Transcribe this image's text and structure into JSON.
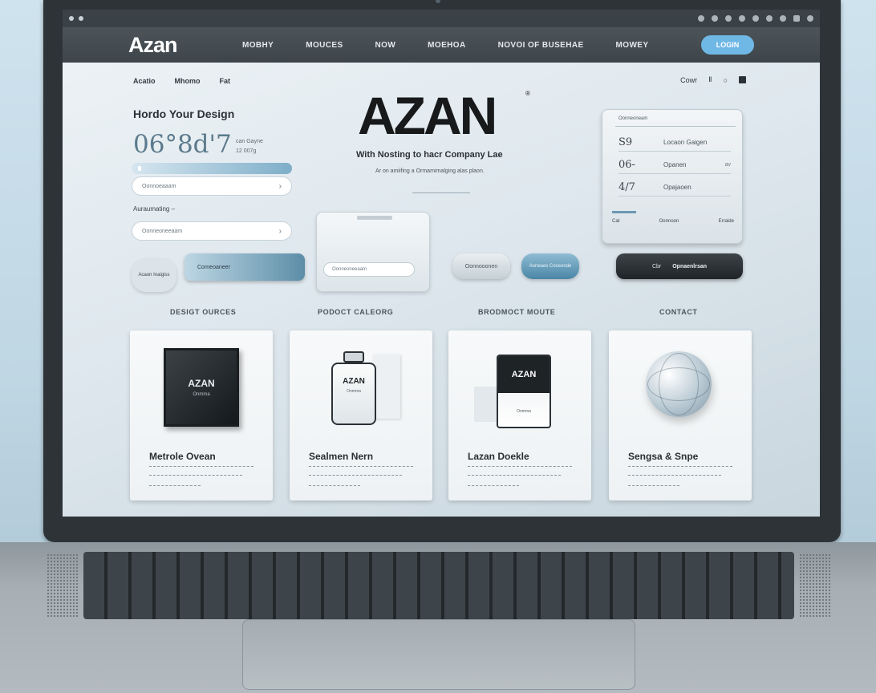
{
  "brand": {
    "logo": "Azan",
    "big": "AZAN",
    "reg": "®"
  },
  "nav": {
    "links": [
      "MOBHY",
      "MOUCES",
      "NOW",
      "MOEHOA",
      "NOVOI OF BUSEHAE",
      "MOWEY"
    ],
    "cta": "LOGIN"
  },
  "crumbs": [
    "Acatio",
    "Mhomo",
    "Fat"
  ],
  "util": {
    "label": "Cowr",
    "glyph1": "Ⅱ",
    "glyph2": "○"
  },
  "left": {
    "heading": "Hordo Your Design",
    "time": "06°8d'7",
    "time_note_1": "can Gayne",
    "time_note_2": "12 007g",
    "input1": "Oonnoeaaam",
    "section": "Auraumating",
    "input2": "Oonneoneeaam",
    "round_btn": "Acaon Inaigiss",
    "grad_btn": "Corneoaneer"
  },
  "center": {
    "tagline": "With Nosting to hacr Company Lae",
    "subtag": "Ar on amiifing a Ormamimalging alas plaon.",
    "field": "Oonneoneeaam",
    "pill_grey": "Oonnooonen",
    "pill_blue": "Aoneaes Coceonde"
  },
  "stats": {
    "header": "Oonneoneam",
    "rows": [
      {
        "value": "S9",
        "label": "Locaon Gaigen",
        "x": ""
      },
      {
        "value": "06-",
        "label": "Opanen",
        "x": "av"
      },
      {
        "value": "4/7",
        "label": "Opajaoen",
        "x": ""
      }
    ],
    "footer": [
      "Cat",
      "Oonnoon",
      "Erraide"
    ]
  },
  "dark_btn": {
    "left": "Cbr",
    "right": "Opnaenlrsan"
  },
  "sections": [
    "DESIGT OURCES",
    "PODOCT CALEORG",
    "BRODMOCT MOUTE",
    "CONTACT"
  ],
  "products": [
    {
      "name": "Metrole Ovean",
      "title": "AZAN",
      "sub": "Onmma"
    },
    {
      "name": "Sealmen Nern",
      "title": "AZAN",
      "sub": "Onmma"
    },
    {
      "name": "Lazan Doekle",
      "title": "AZAN",
      "sub": "Onmma"
    },
    {
      "name": "Sengsa & Snpe",
      "title": "",
      "sub": ""
    }
  ],
  "colors": {
    "accent": "#6fb8e6",
    "dark": "#2e3338",
    "bezel": "#2e3338"
  }
}
